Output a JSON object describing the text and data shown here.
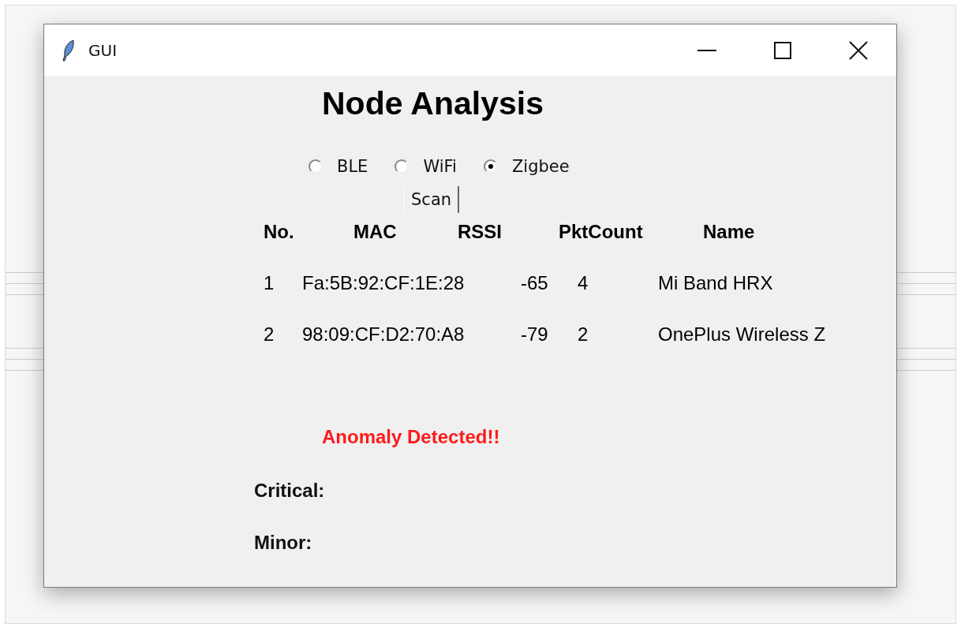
{
  "window": {
    "title": "GUI"
  },
  "heading": "Node Analysis",
  "protocols": [
    {
      "label": "BLE",
      "selected": false
    },
    {
      "label": "WiFi",
      "selected": false
    },
    {
      "label": "Zigbee",
      "selected": true
    }
  ],
  "scan_button": "Scan",
  "table": {
    "columns": [
      "No.",
      "MAC",
      "RSSI",
      "PktCount",
      "Name"
    ],
    "rows": [
      [
        "1",
        "Fa:5B:92:CF:1E:28",
        "-65",
        "4",
        "Mi Band HRX"
      ],
      [
        "2",
        "98:09:CF:D2:70:A8",
        "-79",
        "2",
        "OnePlus Wireless Z"
      ]
    ]
  },
  "alert": "Anomaly Detected!!",
  "fields": [
    {
      "label": "Critical:"
    },
    {
      "label": "Minor:"
    }
  ]
}
